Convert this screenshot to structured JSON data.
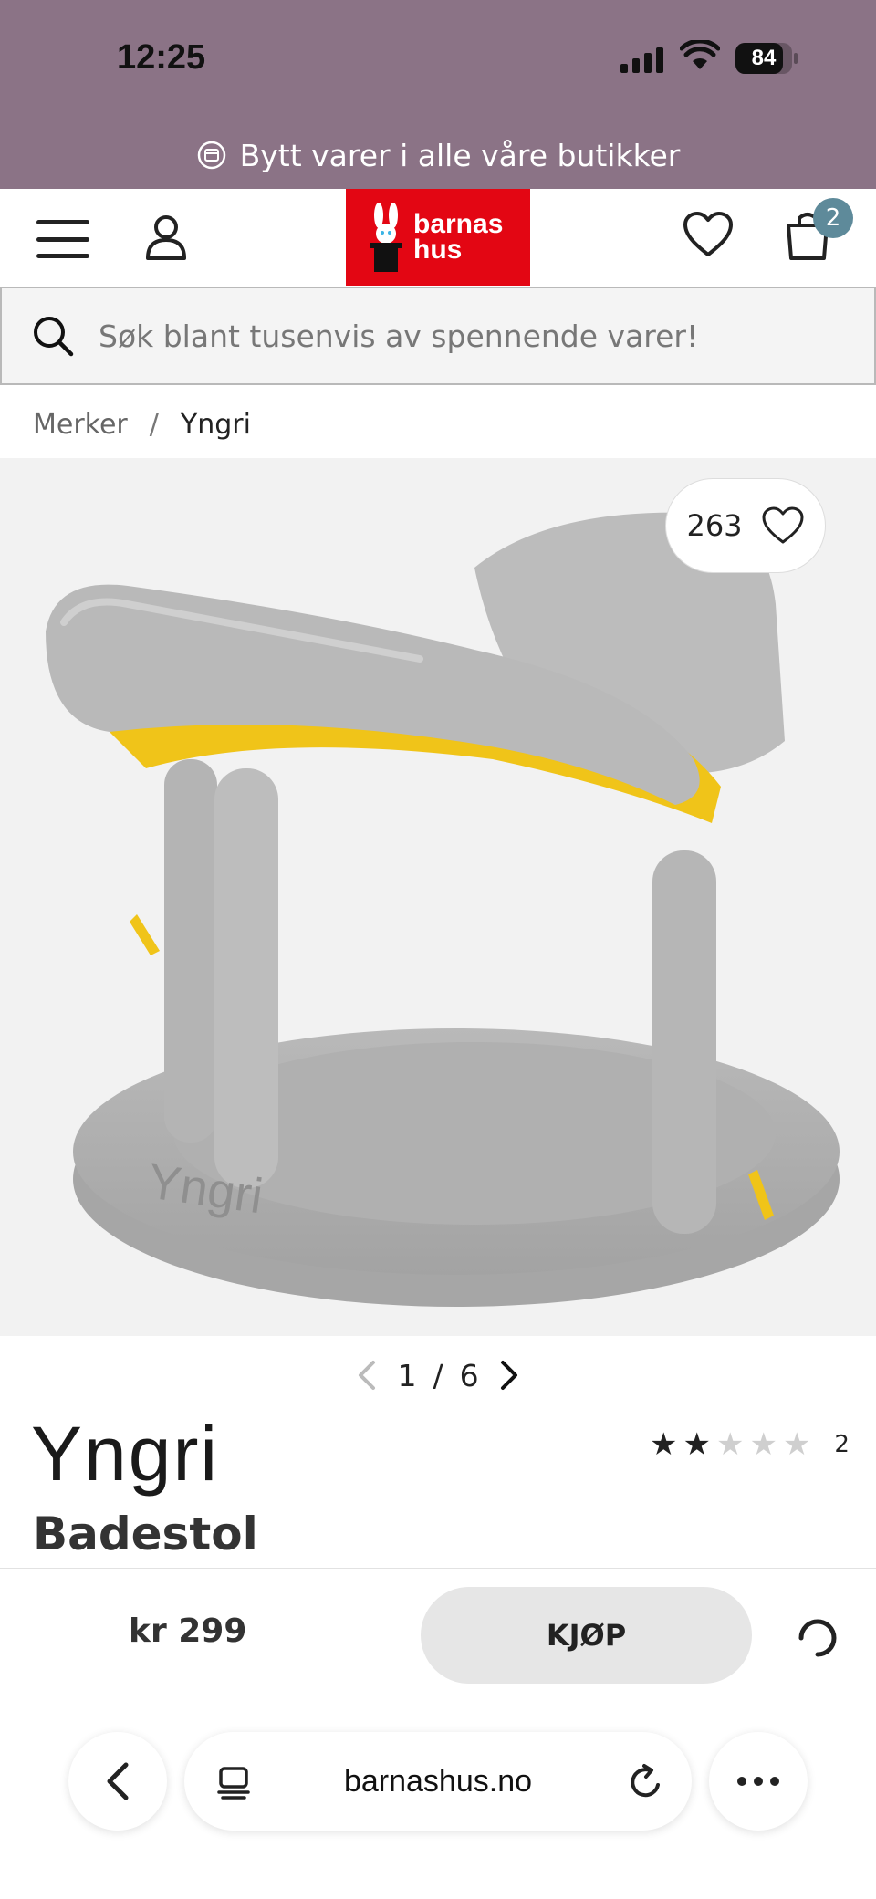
{
  "status_bar": {
    "time": "12:25",
    "battery": "84",
    "battery_level": 0.84
  },
  "banner": {
    "text": "Bytt varer i alle våre butikker",
    "icon": "exchange-icon"
  },
  "header": {
    "logo_line1": "barnas",
    "logo_line2": "hus",
    "cart_count": "2",
    "colors": {
      "logo_bg": "#e30613",
      "banner_bg": "#8b7386",
      "badge_bg": "#5e8a9a"
    }
  },
  "search": {
    "placeholder": "Søk blant tusenvis av spennende varer!"
  },
  "breadcrumb": {
    "items": [
      "Merker",
      "Yngri"
    ],
    "separator": "/"
  },
  "gallery": {
    "likes": "263",
    "current": "1",
    "total": "6",
    "separator": "/",
    "image_brand_text": "Yngri"
  },
  "product": {
    "brand": "Yngri",
    "title": "Badestol",
    "rating": {
      "value": 2,
      "max": 5,
      "count": "2"
    },
    "price": "kr 299",
    "buy_label": "KJØP"
  },
  "browser": {
    "url": "barnashus.no"
  }
}
